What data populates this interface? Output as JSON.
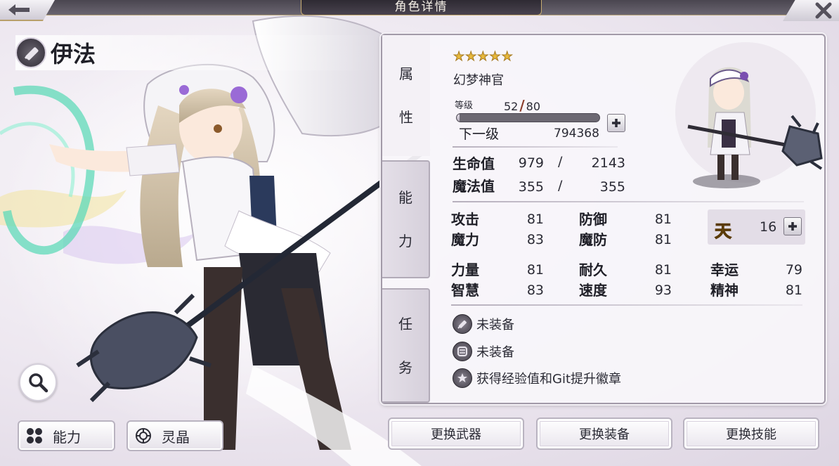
{
  "header": {
    "title": "角色详情",
    "back_icon": "left-arrow-icon",
    "close_icon": "close-icon"
  },
  "character": {
    "name": "伊法",
    "class_icon": "hammer-icon",
    "stars": 5,
    "class_name": "幻梦神官"
  },
  "level": {
    "label": "等级",
    "current": "52",
    "max": "80",
    "exp_fraction": 0.02,
    "next_label": "下一级",
    "next_value": "794368"
  },
  "tabs": [
    {
      "line1": "属",
      "line2": "性"
    },
    {
      "line1": "能",
      "line2": "力"
    },
    {
      "line1": "任",
      "line2": "务"
    }
  ],
  "vitals": {
    "hp_label": "生命值",
    "hp_current": "979",
    "hp_max": "2143",
    "mp_label": "魔法值",
    "mp_current": "355",
    "mp_max": "355",
    "slash": "/"
  },
  "stats": {
    "atk_label": "攻击",
    "atk": "81",
    "def_label": "防御",
    "def": "81",
    "mag_label": "魔力",
    "mag": "83",
    "mdef_label": "魔防",
    "mdef": "81",
    "str_label": "力量",
    "str": "81",
    "dur_label": "耐久",
    "dur": "81",
    "luck_label": "幸运",
    "luck": "79",
    "wis_label": "智慧",
    "wis": "83",
    "spd_label": "速度",
    "spd": "93",
    "spi_label": "精神",
    "spi": "81"
  },
  "sky": {
    "glyph": "天",
    "value": "16"
  },
  "equipment": [
    {
      "icon": "hammer-icon",
      "text": "未装备"
    },
    {
      "icon": "armor-icon",
      "text": "未装备"
    },
    {
      "icon": "star-badge-icon",
      "text": "获得经验值和Git提升徽章"
    }
  ],
  "buttons": {
    "ability": "能力",
    "crystal": "灵晶",
    "change_weapon": "更换武器",
    "change_equip": "更换装备",
    "change_skill": "更换技能"
  },
  "colors": {
    "star": "#e8b93b",
    "accent_gold": "#c8ad72",
    "panel_border": "#a29aa8"
  }
}
